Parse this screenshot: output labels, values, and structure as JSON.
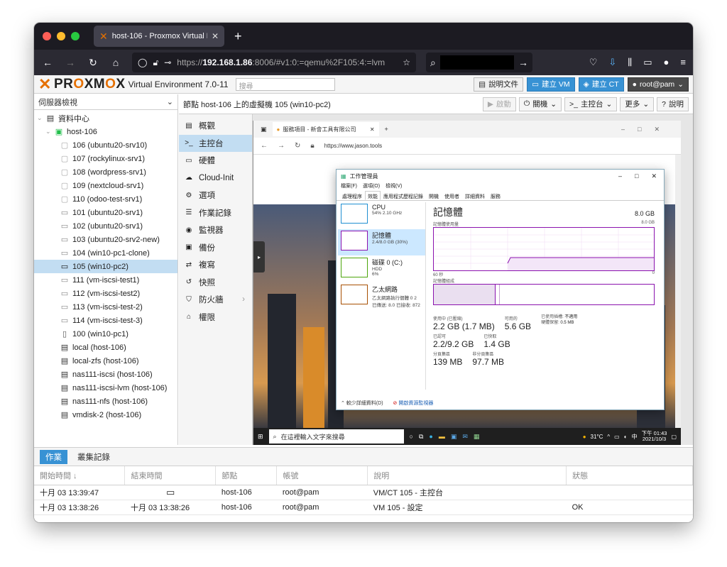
{
  "browser": {
    "tab_title": "host-106 - Proxmox Virtual Envi",
    "url_prefix": "https://",
    "url_host": "192.168.1.86",
    "url_rest": ":8006/#v1:0:=qemu%2F105:4:=lvm"
  },
  "header": {
    "brand": "PROXMOX",
    "subtitle": "Virtual Environment 7.0-11",
    "search_placeholder": "搜尋",
    "docs_label": "說明文件",
    "create_vm_label": "建立 VM",
    "create_ct_label": "建立 CT",
    "user_label": "root@pam"
  },
  "tree": {
    "view": "伺服器檢視",
    "datacenter": "資料中心",
    "host": "host-106",
    "nodes": [
      {
        "label": "106 (ubuntu20-srv10)",
        "kind": "vm-off"
      },
      {
        "label": "107 (rockylinux-srv1)",
        "kind": "vm-off"
      },
      {
        "label": "108 (wordpress-srv1)",
        "kind": "vm-off"
      },
      {
        "label": "109 (nextcloud-srv1)",
        "kind": "vm-off"
      },
      {
        "label": "110 (odoo-test-srv1)",
        "kind": "vm-off"
      },
      {
        "label": "101 (ubuntu20-srv1)",
        "kind": "monitor"
      },
      {
        "label": "102 (ubuntu20-srv1)",
        "kind": "monitor"
      },
      {
        "label": "103 (ubuntu20-srv2-new)",
        "kind": "monitor"
      },
      {
        "label": "104 (win10-pc1-clone)",
        "kind": "monitor"
      },
      {
        "label": "105 (win10-pc2)",
        "kind": "monitor-running"
      },
      {
        "label": "111 (vm-iscsi-test1)",
        "kind": "monitor"
      },
      {
        "label": "112 (vm-iscsi-test2)",
        "kind": "monitor"
      },
      {
        "label": "113 (vm-iscsi-test-2)",
        "kind": "monitor"
      },
      {
        "label": "114 (vm-iscsi-test-3)",
        "kind": "monitor"
      },
      {
        "label": "100 (win10-pc1)",
        "kind": "template"
      },
      {
        "label": "local (host-106)",
        "kind": "storage"
      },
      {
        "label": "local-zfs (host-106)",
        "kind": "storage"
      },
      {
        "label": "nas111-iscsi (host-106)",
        "kind": "storage"
      },
      {
        "label": "nas111-iscsi-lvm (host-106)",
        "kind": "storage"
      },
      {
        "label": "nas111-nfs (host-106)",
        "kind": "storage"
      },
      {
        "label": "vmdisk-2 (host-106)",
        "kind": "storage"
      }
    ]
  },
  "content": {
    "title": "節點 host-106 上的虛擬機 105 (win10-pc2)",
    "btn_start": "啟動",
    "btn_shutdown": "關機",
    "btn_console": "主控台",
    "btn_more": "更多",
    "btn_help": "說明"
  },
  "vmmenu": [
    {
      "label": "概觀",
      "icon": "book-icon"
    },
    {
      "label": "主控台",
      "icon": "terminal-icon"
    },
    {
      "label": "硬體",
      "icon": "desktop-icon"
    },
    {
      "label": "Cloud-Init",
      "icon": "cloud-icon"
    },
    {
      "label": "選項",
      "icon": "gear-icon"
    },
    {
      "label": "作業記錄",
      "icon": "list-icon"
    },
    {
      "label": "監視器",
      "icon": "eye-icon"
    },
    {
      "label": "備份",
      "icon": "floppy-icon"
    },
    {
      "label": "複寫",
      "icon": "retweet-icon"
    },
    {
      "label": "快照",
      "icon": "history-icon"
    },
    {
      "label": "防火牆",
      "icon": "shield-icon"
    },
    {
      "label": "權限",
      "icon": "unlock-icon"
    }
  ],
  "guest": {
    "edge_tab": "服務項目 - 新會工具有限公司",
    "edge_url": "https://www.jason.tools",
    "taskbar_search": "在這裡輸入文字來搜尋",
    "temp": "31°C",
    "ime": "中",
    "time": "下午 01:43",
    "date": "2021/10/3",
    "taskmgr": {
      "title": "工作管理員",
      "menu": [
        "檔案(F)",
        "選項(O)",
        "檢視(V)"
      ],
      "tabs": [
        "處理程序",
        "效能",
        "應用程式歷程記錄",
        "開機",
        "使用者",
        "詳細資料",
        "服務"
      ],
      "left": [
        {
          "name": "CPU",
          "sub": "54% 2.10 GHz"
        },
        {
          "name": "記憶體",
          "sub": "2.4/8.0 GB (30%)"
        },
        {
          "name": "磁碟 0 (C:)",
          "sub": "HDD",
          "sub2": "6%"
        },
        {
          "name": "乙太網路",
          "sub": "乙太網路執行個體 0 2",
          "sub2": "已傳送: 8.0 已接收: 872"
        }
      ],
      "heading": "記憶體",
      "capacity": "8.0 GB",
      "graph_label": "記憶體使用量",
      "graph_max": "8.0 GB",
      "axis_left": "60 秒",
      "axis_right": "0",
      "comp_label": "記憶體組成",
      "in_use_label": "使用中 (已壓縮)",
      "in_use": "2.2 GB (1.7 MB)",
      "available_label": "可用的",
      "available": "5.6 GB",
      "committed_label": "已認可",
      "committed": "2.2/9.2 GB",
      "cached_label": "已快取",
      "cached": "1.4 GB",
      "paged_label": "分頁集區",
      "paged": "139 MB",
      "nonpaged_label": "非分頁集區",
      "nonpaged": "97.7 MB",
      "hw_reserved_label": "已使用插槽:",
      "hw_reserved": "不適用",
      "hw_reserved2_label": "硬體保留:",
      "hw_reserved2": "0.5 MB",
      "fewer_details": "較少詳細資料(D)",
      "open_monitor": "開啟資源監視器"
    }
  },
  "log": {
    "tabs": [
      "作業",
      "叢集記錄"
    ],
    "columns": [
      "開始時間 ↓",
      "結束時間",
      "節點",
      "帳號",
      "說明",
      "狀態"
    ],
    "rows": [
      {
        "start": "十月 03 13:39:47",
        "end": "",
        "node": "host-106",
        "user": "root@pam",
        "desc": "VM/CT 105 - 主控台",
        "status": ""
      },
      {
        "start": "十月 03 13:38:26",
        "end": "十月 03 13:38:26",
        "node": "host-106",
        "user": "root@pam",
        "desc": "VM 105 - 設定",
        "status": "OK"
      }
    ]
  }
}
